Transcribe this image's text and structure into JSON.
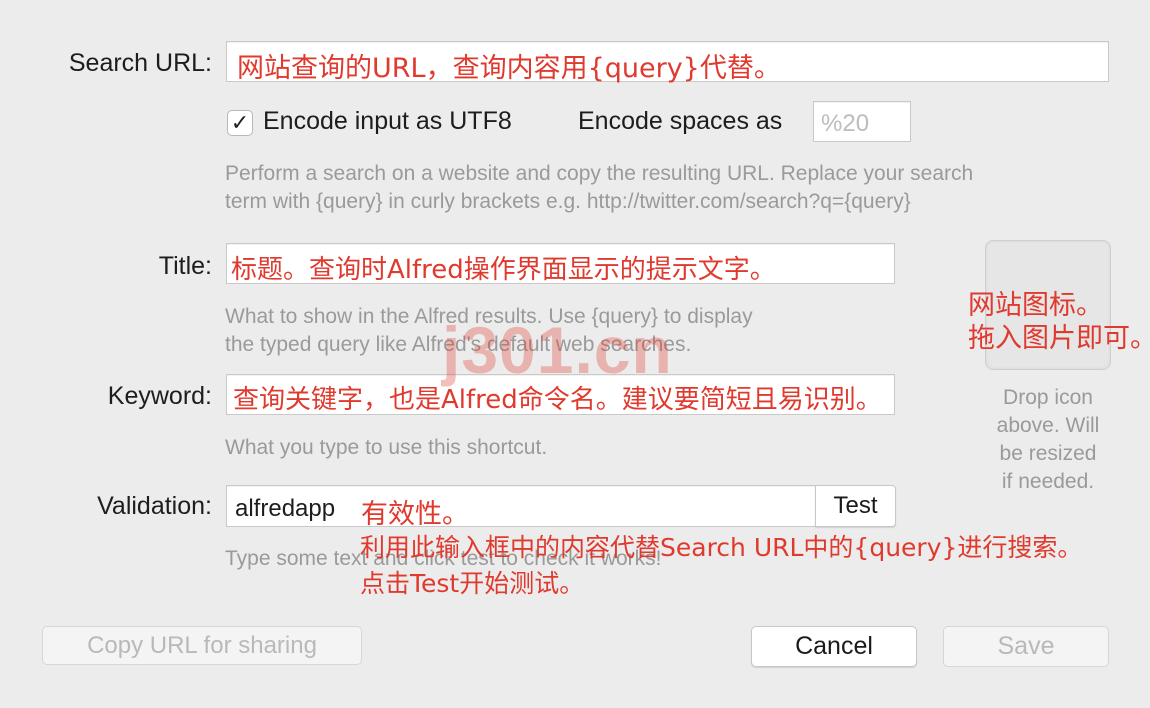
{
  "search_url": {
    "label": "Search URL:",
    "annotation": "网站查询的URL，查询内容用{query}代替。"
  },
  "encode": {
    "checkbox_checked": true,
    "checkbox_mark": "✓",
    "checkbox_label": "Encode input as UTF8",
    "spaces_label": "Encode spaces as",
    "spaces_placeholder": "%20",
    "help_line1": "Perform a search on a website and copy the resulting URL. Replace your search",
    "help_line2": "term with {query} in curly brackets e.g. http://twitter.com/search?q={query}"
  },
  "title": {
    "label": "Title:",
    "annotation": "标题。查询时Alfred操作界面显示的提示文字。",
    "help_line1": "What to show in the Alfred results. Use {query} to display",
    "help_line2": "the typed query like Alfred's default web searches."
  },
  "keyword": {
    "label": "Keyword:",
    "annotation": "查询关键字，也是Alfred命令名。建议要简短且易识别。",
    "help": "What you type to use this shortcut."
  },
  "validation": {
    "label": "Validation:",
    "value": "alfredapp",
    "annotation": "有效性。",
    "test_label": "Test",
    "help": "Type some text and click test to check it works!",
    "annotation_line2": "利用此输入框中的内容代替Search URL中的{query}进行搜索。",
    "annotation_line3": "点击Test开始测试。"
  },
  "icon_well": {
    "annotation_line1": "网站图标。",
    "annotation_line2": "拖入图片即可。",
    "caption_line1": "Drop icon",
    "caption_line2": "above. Will",
    "caption_line3": "be resized",
    "caption_line4": "if needed."
  },
  "watermark": "j301.cn",
  "buttons": {
    "copy_url": "Copy URL for sharing",
    "cancel": "Cancel",
    "save": "Save"
  },
  "colors": {
    "annotation": "#e03a2e",
    "watermark": "#e03a2e",
    "help_text": "#9a9a9a",
    "background": "#ececec"
  }
}
